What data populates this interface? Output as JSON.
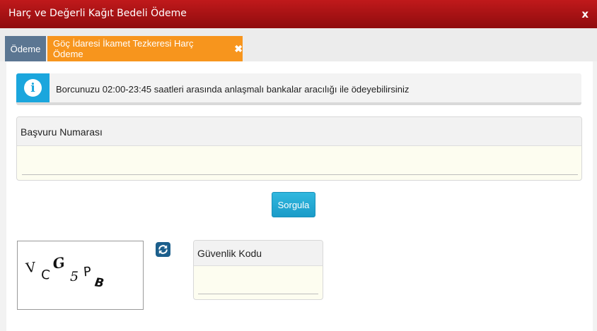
{
  "window": {
    "title": "Harç ve Değerli Kağıt Bedeli Ödeme",
    "close_label": "x"
  },
  "tabs": {
    "home_label": "Ödeme",
    "active_label": "Göç İdaresi İkamet Tezkeresi Harç Ödeme",
    "active_close": "✖"
  },
  "info": {
    "icon": "info-icon",
    "glyph": "i",
    "message": "Borcunuzu 02:00-23:45 saatleri arasında anlaşmalı bankalar aracılığı ile ödeyebilirsiniz"
  },
  "application": {
    "label": "Başvuru Numarası",
    "value": "",
    "placeholder": ""
  },
  "query_button": "Sorgula",
  "captcha": {
    "text": "VCG5PB",
    "refresh_icon": "refresh-icon"
  },
  "security": {
    "label": "Güvenlik Kodu",
    "value": "",
    "placeholder": ""
  },
  "colors": {
    "title_bar": "#b01416",
    "tab_home": "#5b7692",
    "tab_active": "#f7951d",
    "info_badge": "#1ba6dd",
    "button": "#22a8d4"
  }
}
